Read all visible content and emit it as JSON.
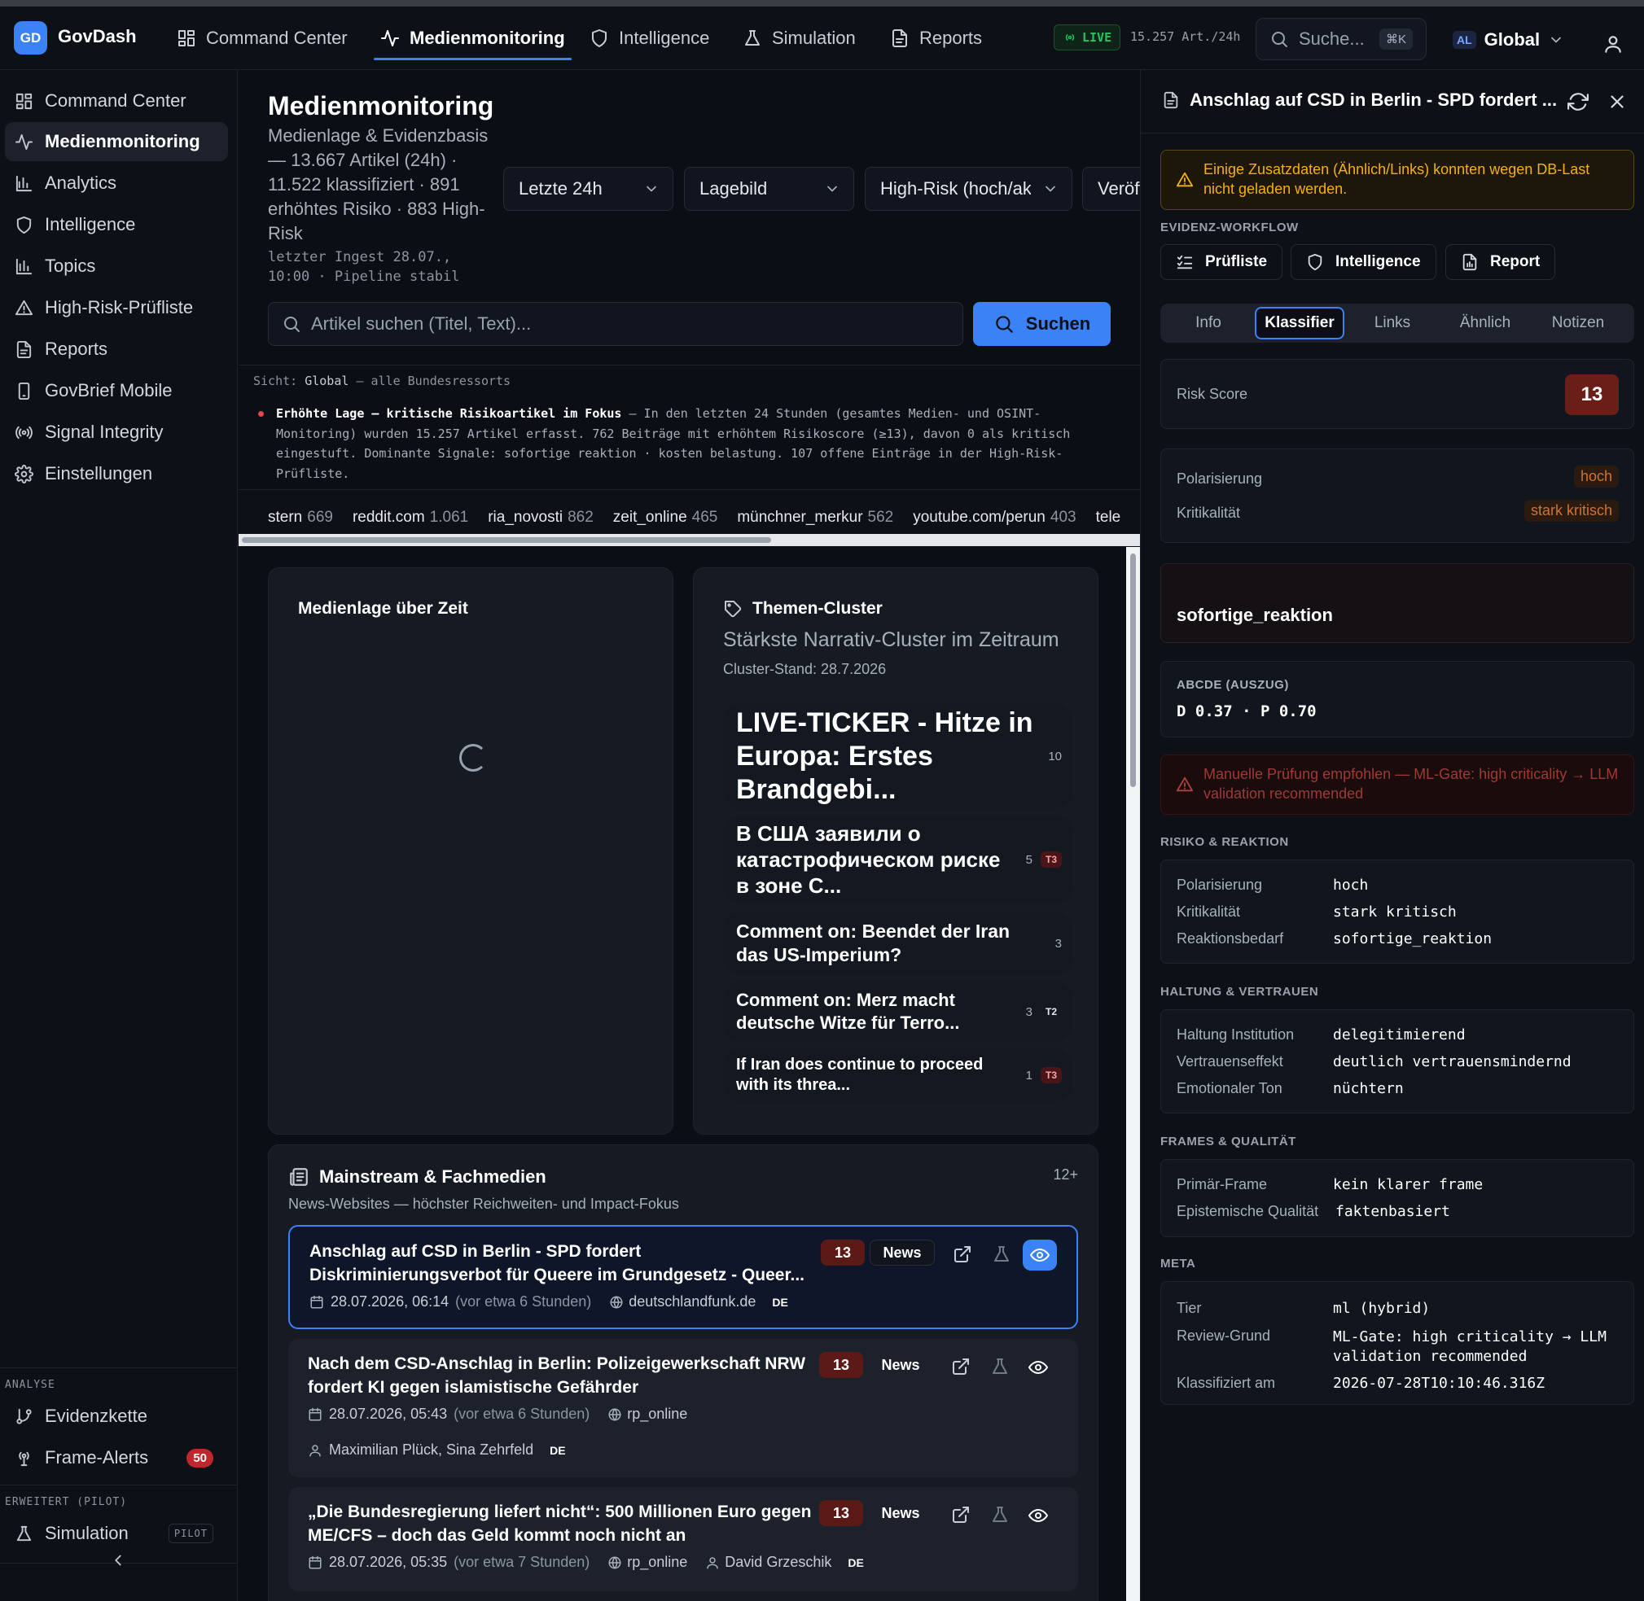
{
  "app": {
    "logo": "GD",
    "name": "GovDash"
  },
  "topnav": [
    {
      "label": "Command Center",
      "icon": "grid-icon"
    },
    {
      "label": "Medienmonitoring",
      "icon": "activity-icon",
      "active": true
    },
    {
      "label": "Intelligence",
      "icon": "shield-icon"
    },
    {
      "label": "Simulation",
      "icon": "flask-icon"
    },
    {
      "label": "Reports",
      "icon": "file-icon"
    }
  ],
  "status": {
    "live": "LIVE",
    "rate": "15.257 Art./24h"
  },
  "topsearch": {
    "placeholder": "Suche...",
    "shortcut": "⌘K"
  },
  "scope": {
    "badge": "AL",
    "label": "Global"
  },
  "sidebar": {
    "items": [
      {
        "label": "Command Center"
      },
      {
        "label": "Medienmonitoring",
        "active": true
      },
      {
        "label": "Analytics"
      },
      {
        "label": "Intelligence"
      },
      {
        "label": "Topics"
      },
      {
        "label": "High-Risk-Prüfliste"
      },
      {
        "label": "Reports"
      },
      {
        "label": "GovBrief Mobile"
      },
      {
        "label": "Signal Integrity"
      },
      {
        "label": "Einstellungen"
      }
    ],
    "group_analyse": "ANALYSE",
    "evidenzkette": "Evidenzkette",
    "frame_alerts": "Frame-Alerts",
    "frame_alerts_count": "50",
    "group_erweitert": "ERWEITERT (PILOT)",
    "simulation": "Simulation",
    "simulation_badge": "PILOT"
  },
  "page": {
    "title": "Medienmonitoring",
    "subtitle": "Medienlage & Evidenzbasis — 13.667 Artikel (24h) · 11.522 klassifiziert · 891 erhöhtes Risiko · 883 High-Risk",
    "ingest": "letzter Ingest 28.07., 10:00 · Pipeline stabil"
  },
  "filters": {
    "time": "Letzte 24h",
    "view": "Lagebild",
    "risk": "High-Risk (hoch/akut)",
    "fourth": "Veröffentlicht"
  },
  "search": {
    "placeholder": "Artikel suchen (Titel, Text)...",
    "button": "Suchen"
  },
  "sicht": {
    "label": "Sicht:",
    "scope": "Global",
    "rest": "— alle Bundesressorts"
  },
  "alert": {
    "title": "Erhöhte Lage – kritische Risikoartikel im Fokus",
    "text": "— In den letzten 24 Stunden (gesamtes Medien- und OSINT-Monitoring) wurden 15.257 Artikel erfasst. 762 Beiträge mit erhöhtem Risikoscore (≥13), davon 0 als kritisch eingestuft. Dominante Signale: sofortige reaktion · kosten belastung. 107 offene Einträge in der High-Risk-Prüfliste."
  },
  "sources": [
    {
      "name": "stern",
      "count": "669"
    },
    {
      "name": "reddit.com",
      "count": "1.061"
    },
    {
      "name": "ria_novosti",
      "count": "862"
    },
    {
      "name": "zeit_online",
      "count": "465"
    },
    {
      "name": "münchner_merkur",
      "count": "562"
    },
    {
      "name": "youtube.com/perun",
      "count": "403"
    },
    {
      "name": "tele",
      "count": ""
    }
  ],
  "timeline": {
    "title": "Medienlage über Zeit"
  },
  "clusters": {
    "title": "Themen-Cluster",
    "subtitle": "Stärkste Narrativ-Cluster im Zeitraum",
    "stand": "Cluster-Stand: 28.7.2026",
    "items": [
      {
        "title": "LIVE-TICKER - Hitze in Europa: Erstes Brandgebi...",
        "count": "10",
        "tier": ""
      },
      {
        "title": "В США заявили о катастрофическом риске в зоне С...",
        "count": "5",
        "tier": "T3"
      },
      {
        "title": "Comment on: Beendet der Iran das US-Imperium?",
        "count": "3",
        "tier": ""
      },
      {
        "title": "Comment on: Merz macht deutsche Witze für Terro...",
        "count": "3",
        "tier": "T2"
      },
      {
        "title": "If Iran does continue to proceed with its threa...",
        "count": "1",
        "tier": "T3"
      }
    ]
  },
  "mainstream": {
    "title": "Mainstream & Fachmedien",
    "subtitle": "News-Websites — höchster Reichweiten- und Impact-Fokus",
    "count": "12+",
    "articles": [
      {
        "title": "Anschlag auf CSD in Berlin - SPD fordert Diskriminierungsverbot für Queere im Grundgesetz - Queer...",
        "score": "13",
        "type": "News",
        "date": "28.07.2026, 06:14",
        "rel": "(vor etwa 6 Stunden)",
        "source": "deutschlandfunk.de",
        "author": "",
        "lang": "DE"
      },
      {
        "title": "Nach dem CSD-Anschlag in Berlin: Polizeigewerkschaft NRW fordert KI gegen islamistische Gefährder",
        "score": "13",
        "type": "News",
        "date": "28.07.2026, 05:43",
        "rel": "(vor etwa 6 Stunden)",
        "source": "rp_online",
        "author": "Maximilian Plück, Sina Zehrfeld",
        "lang": "DE"
      },
      {
        "title": "„Die Bundesregierung liefert nicht“: 500 Millionen Euro gegen ME/CFS – doch das Geld kommt noch nicht an",
        "score": "13",
        "type": "News",
        "date": "28.07.2026, 05:35",
        "rel": "(vor etwa 7 Stunden)",
        "source": "rp_online",
        "author": "David Grzeschik",
        "lang": "DE"
      }
    ]
  },
  "detail": {
    "title": "Anschlag auf CSD in Berlin - SPD fordert ...",
    "warning": "Einige Zusatzdaten (Ähnlich/Links) konnten wegen DB-Last nicht geladen werden.",
    "workflow_label": "EVIDENZ-WORKFLOW",
    "workflow": [
      "Prüfliste",
      "Intelligence",
      "Report"
    ],
    "tabs": [
      "Info",
      "Klassifier",
      "Links",
      "Ähnlich",
      "Notizen"
    ],
    "active_tab": "Klassifier",
    "risk_label": "Risk Score",
    "risk_value": "13",
    "polarisierung_label": "Polarisierung",
    "polarisierung": "hoch",
    "kritikalitaet_label": "Kritikalität",
    "kritikalitaet": "stark kritisch",
    "reaktion_label": "REAKTIONSBEDARF",
    "reaktion": "sofortige_reaktion",
    "abcde_label": "ABCDE (AUSZUG)",
    "abcde": "D 0.37 · P 0.70",
    "manual": "Manuelle Prüfung empfohlen — ML-Gate: high criticality → LLM validation recommended",
    "risiko_section": "RISIKO & REAKTION",
    "risiko_rows": [
      {
        "k": "Polarisierung",
        "v": "hoch"
      },
      {
        "k": "Kritikalität",
        "v": "stark kritisch"
      },
      {
        "k": "Reaktionsbedarf",
        "v": "sofortige_reaktion"
      }
    ],
    "haltung_section": "HALTUNG & VERTRAUEN",
    "haltung_rows": [
      {
        "k": "Haltung Institution",
        "v": "delegitimierend"
      },
      {
        "k": "Vertrauenseffekt",
        "v": "deutlich vertrauensmindernd"
      },
      {
        "k": "Emotionaler Ton",
        "v": "nüchtern"
      }
    ],
    "frames_section": "FRAMES & QUALITÄT",
    "frames_rows": [
      {
        "k": "Primär-Frame",
        "v": "kein klarer frame"
      },
      {
        "k": "Epistemische Qualität",
        "v": "faktenbasiert"
      }
    ],
    "meta_section": "META",
    "meta_rows": [
      {
        "k": "Tier",
        "v": "ml (hybrid)"
      },
      {
        "k": "Review-Grund",
        "v": "ML-Gate: high criticality → LLM validation recommended"
      },
      {
        "k": "Klassifiziert am",
        "v": "2026-07-28T10:10:46.316Z"
      }
    ]
  },
  "colors": {
    "accent": "#3b82f6",
    "danger": "#c0262d",
    "warning": "#f5b10b",
    "live": "#22c55e"
  }
}
